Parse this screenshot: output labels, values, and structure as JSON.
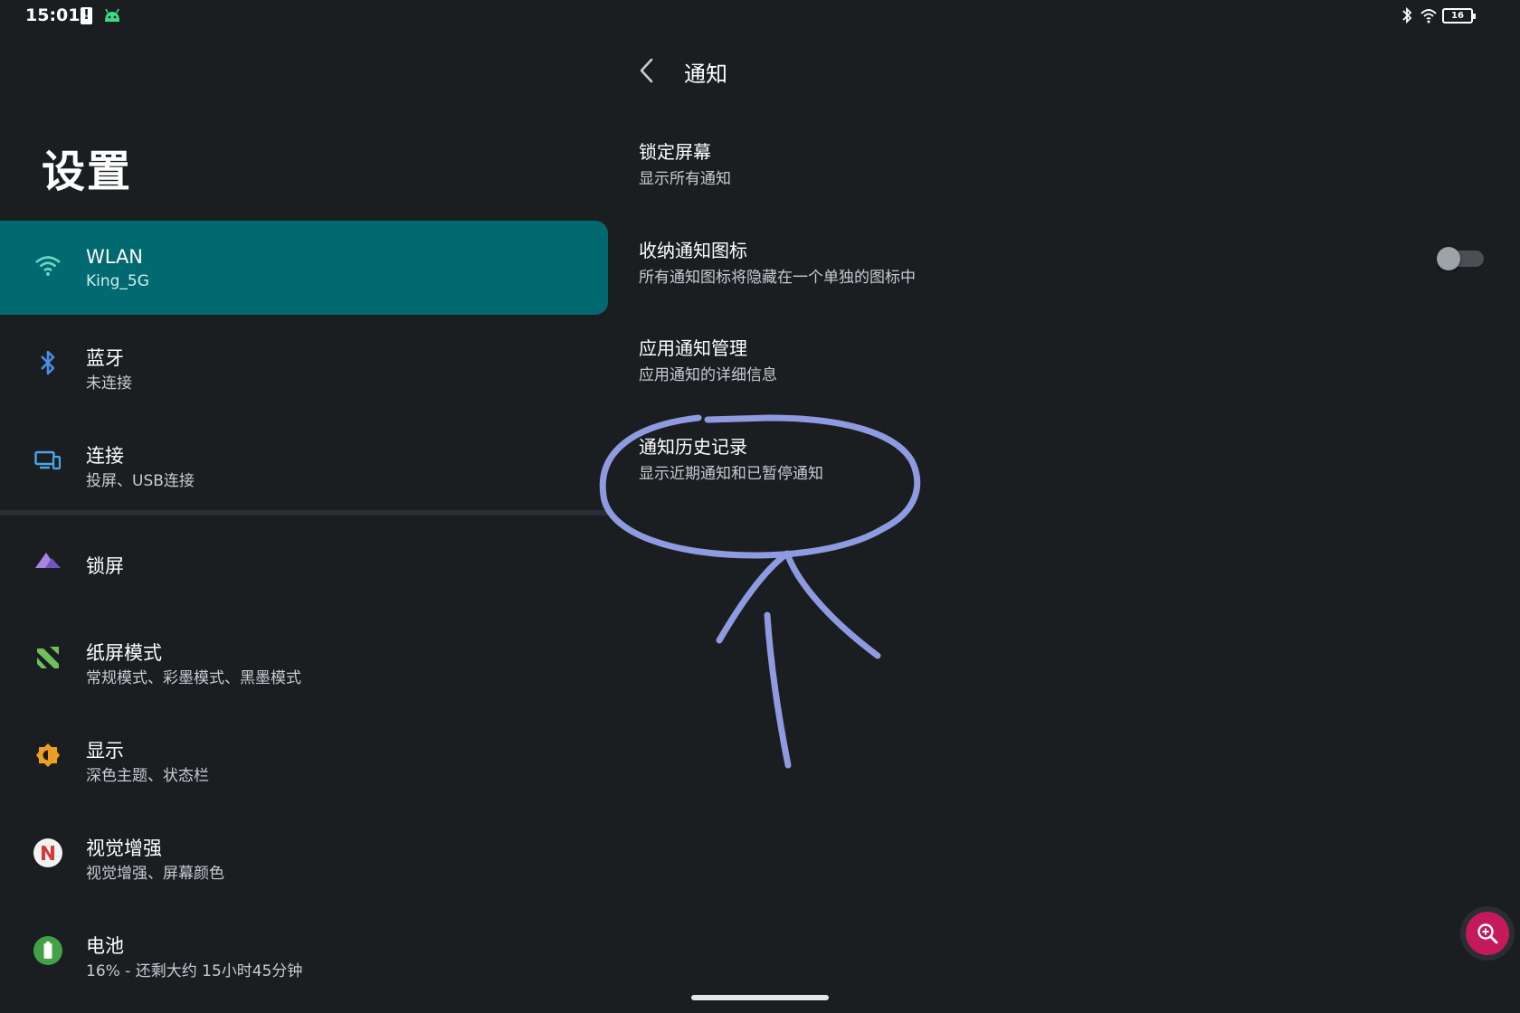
{
  "status_bar": {
    "time": "15:01",
    "battery_level": "16",
    "icons": [
      "alert-icon",
      "android-icon",
      "bluetooth-icon",
      "wifi-icon",
      "battery-icon"
    ]
  },
  "sidebar": {
    "title": "设置",
    "items": [
      {
        "title": "WLAN",
        "subtitle": "King_5G",
        "icon": "wifi-icon",
        "selected": true
      },
      {
        "title": "蓝牙",
        "subtitle": "未连接",
        "icon": "bluetooth-icon"
      },
      {
        "title": "连接",
        "subtitle": "投屏、USB连接",
        "icon": "devices-icon"
      },
      {
        "title": "锁屏",
        "subtitle": "",
        "icon": "lockscreen-icon"
      },
      {
        "title": "纸屏模式",
        "subtitle": "常规模式、彩墨模式、黑墨模式",
        "icon": "paper-mode-icon"
      },
      {
        "title": "显示",
        "subtitle": "深色主题、状态栏",
        "icon": "brightness-icon"
      },
      {
        "title": "视觉增强",
        "subtitle": "视觉增强、屏幕颜色",
        "icon": "vision-icon"
      },
      {
        "title": "电池",
        "subtitle": "16% - 还剩大约 15小时45分钟",
        "icon": "battery-icon"
      }
    ]
  },
  "detail": {
    "title": "通知",
    "items": [
      {
        "title": "锁定屏幕",
        "subtitle": "显示所有通知"
      },
      {
        "title": "收纳通知图标",
        "subtitle": "所有通知图标将隐藏在一个单独的图标中",
        "toggle": false
      },
      {
        "title": "应用通知管理",
        "subtitle": "应用通知的详细信息"
      },
      {
        "title": "通知历史记录",
        "subtitle": "显示近期通知和已暂停通知"
      }
    ]
  },
  "colors": {
    "background": "#1b1e21",
    "selected": "#016a70",
    "annotation": "#8e9be0",
    "fab": "#c41a5a"
  }
}
